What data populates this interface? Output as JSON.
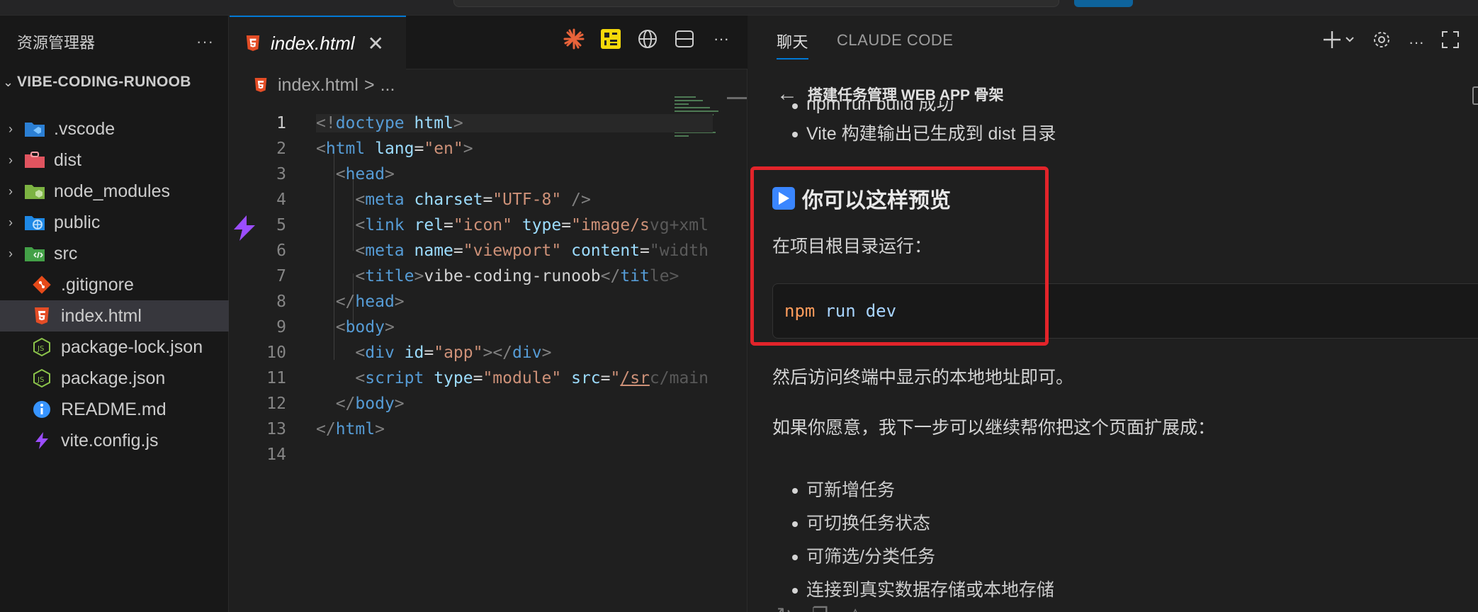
{
  "explorer": {
    "title": "资源管理器",
    "more": "···",
    "project": "VIBE-CODING-RUNOOB",
    "items": [
      {
        "label": ".vscode",
        "type": "folder"
      },
      {
        "label": "dist",
        "type": "folder"
      },
      {
        "label": "node_modules",
        "type": "folder"
      },
      {
        "label": "public",
        "type": "folder"
      },
      {
        "label": "src",
        "type": "folder"
      },
      {
        "label": ".gitignore",
        "type": "file"
      },
      {
        "label": "index.html",
        "type": "file",
        "active": true
      },
      {
        "label": "package-lock.json",
        "type": "file"
      },
      {
        "label": "package.json",
        "type": "file"
      },
      {
        "label": "README.md",
        "type": "file"
      },
      {
        "label": "vite.config.js",
        "type": "file"
      }
    ]
  },
  "editor": {
    "tab_label": "index.html",
    "close": "✕",
    "more": "···",
    "breadcrumb_file": "index.html",
    "breadcrumb_sep": ">",
    "breadcrumb_more": "...",
    "line_numbers": [
      "1",
      "2",
      "3",
      "4",
      "5",
      "6",
      "7",
      "8",
      "9",
      "10",
      "11",
      "12",
      "13",
      "14"
    ]
  },
  "chat": {
    "tab_chat": "聊天",
    "tab_claude": "CLAUDE CODE",
    "task_title": "搭建任务管理 WEB APP 骨架",
    "bullet_cut": "npm run build 成功",
    "bullet_vite": "Vite 构建输出已生成到 dist 目录",
    "heading": "你可以这样预览",
    "run_in_root": "在项目根目录运行：",
    "code_cmd": "npm",
    "code_arg1": "run",
    "code_arg2": "dev",
    "visit": "然后访问终端中显示的本地地址即可。",
    "next_step": "如果你愿意，我下一步可以继续帮你把这个页面扩展成：",
    "bullets": [
      "可新增任务",
      "可切换任务状态",
      "可筛选/分类任务",
      "连接到真实数据存储或本地存储"
    ]
  },
  "colors": {
    "accent": "#0078d4",
    "highlight_box": "#e2242a",
    "html_icon": "#e44d26",
    "vite_icon": "#9b4dff",
    "json_icon": "#8bc34a",
    "readme_icon": "#3794ff"
  }
}
